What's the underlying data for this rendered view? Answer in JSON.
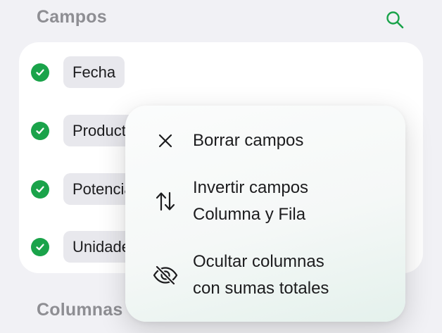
{
  "sections": {
    "fields_title": "Campos",
    "columns_title": "Columnas"
  },
  "fields": [
    {
      "label": "Fecha",
      "checked": true
    },
    {
      "label": "Producto",
      "checked": true
    },
    {
      "label": "Potencia",
      "checked": true
    },
    {
      "label": "Unidades",
      "checked": true
    }
  ],
  "menu": {
    "items": [
      {
        "lines": [
          "Borrar campos"
        ],
        "icon": "close-icon"
      },
      {
        "lines": [
          "Invertir campos",
          "Columna y Fila"
        ],
        "icon": "swap-arrows-icon"
      },
      {
        "lines": [
          "Ocultar columnas",
          "con sumas totales"
        ],
        "icon": "eye-slash-icon"
      }
    ]
  },
  "colors": {
    "accent": "#1aa34a",
    "background": "#f1f1f5"
  }
}
